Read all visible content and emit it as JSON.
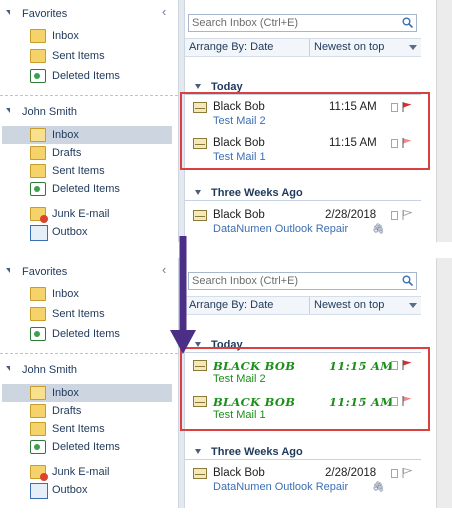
{
  "nav": {
    "favorites_label": "Favorites",
    "favorites": [
      "Inbox",
      "Sent Items",
      "Deleted Items"
    ],
    "account_label": "John Smith",
    "account_items": [
      "Inbox",
      "Drafts",
      "Sent Items",
      "Deleted Items"
    ],
    "extra_items": [
      "Junk E-mail",
      "Outbox"
    ],
    "collapse_glyph": "‹"
  },
  "list": {
    "search_placeholder": "Search Inbox (Ctrl+E)",
    "arrange_by": "Arrange By: Date",
    "sort_order": "Newest on top",
    "groups": {
      "today": "Today",
      "older": "Three Weeks Ago"
    },
    "messages": [
      {
        "from": "Black Bob",
        "time": "11:15 AM",
        "subject": "Test Mail 2"
      },
      {
        "from": "Black Bob",
        "time": "11:15 AM",
        "subject": "Test Mail 1"
      }
    ],
    "older_message": {
      "from": "Black Bob",
      "date": "2/28/2018",
      "subject": "DataNumen Outlook Repair"
    },
    "styled_messages": [
      {
        "from": "BLACK BOB",
        "time": "11:15 AM",
        "subject": "Test Mail 2"
      },
      {
        "from": "BLACK BOB",
        "time": "11:15 AM",
        "subject": "Test Mail 1"
      }
    ]
  },
  "colors": {
    "highlight_box": "#d94040",
    "arrow": "#4b2f86",
    "styled_text": "#1a8f1a",
    "flag_red": "#d32f2f"
  },
  "icons": [
    "folder-icon",
    "trash-icon",
    "junk-icon",
    "outbox-icon",
    "envelope-icon",
    "flag-icon",
    "paperclip-icon",
    "search-icon"
  ]
}
